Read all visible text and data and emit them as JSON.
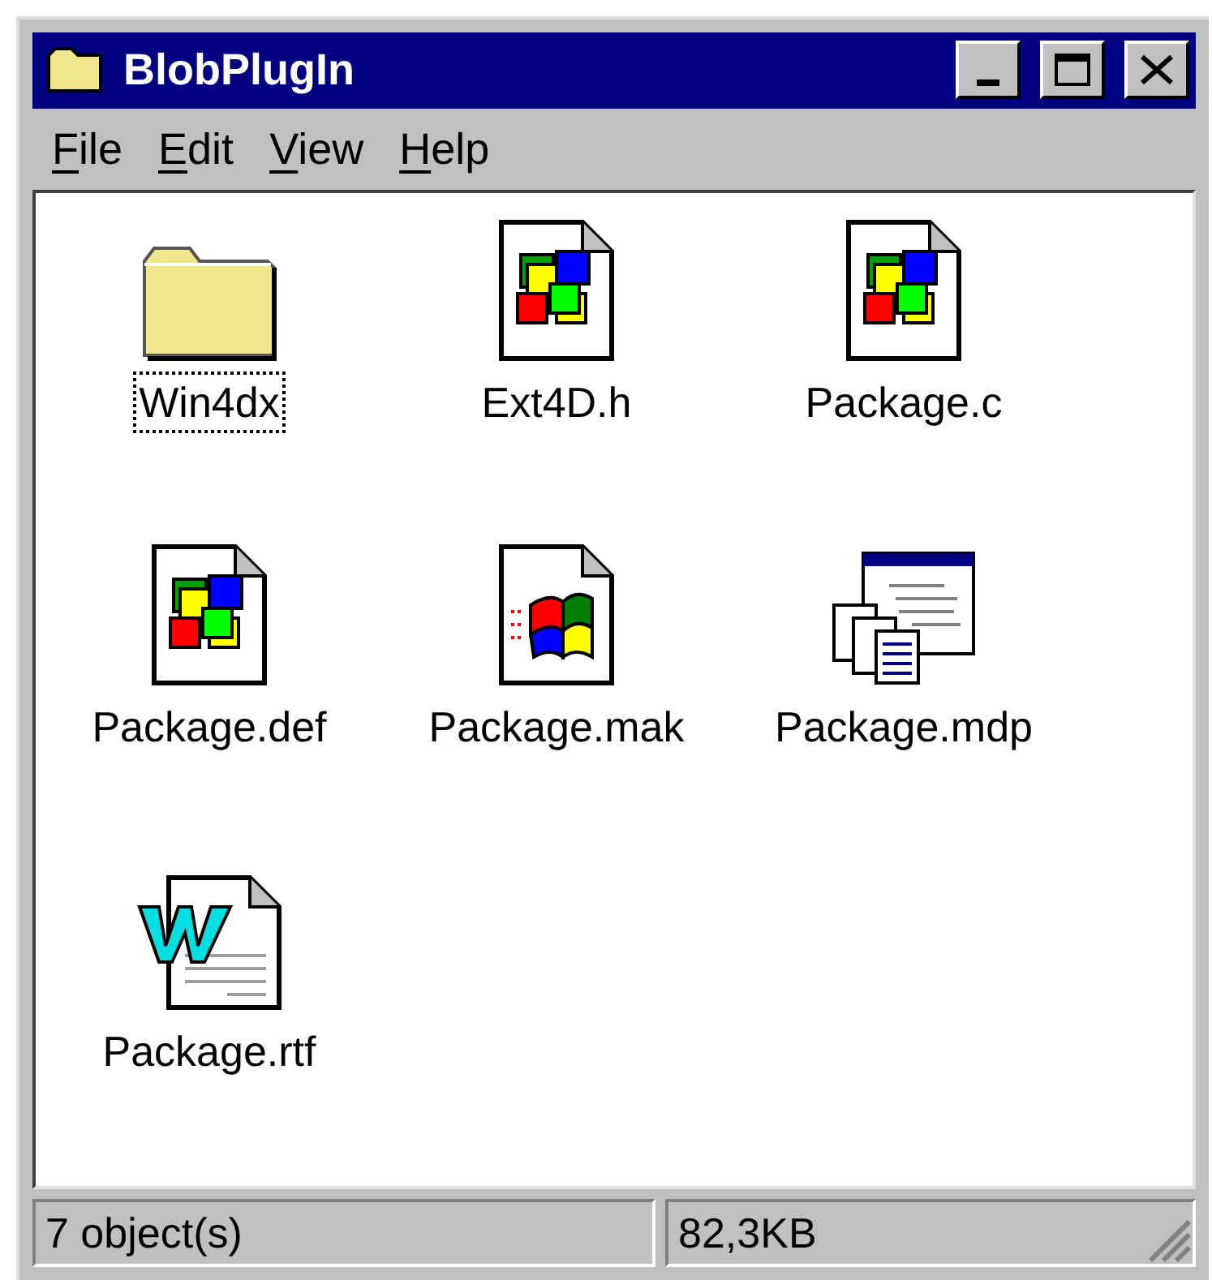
{
  "window": {
    "title": "BlobPlugIn"
  },
  "menu": [
    {
      "label": "File"
    },
    {
      "label": "Edit"
    },
    {
      "label": "View"
    },
    {
      "label": "Help"
    }
  ],
  "items": [
    {
      "name": "Win4dx",
      "kind": "folder",
      "focused": true
    },
    {
      "name": "Ext4D.h",
      "kind": "source",
      "focused": false
    },
    {
      "name": "Package.c",
      "kind": "source",
      "focused": false
    },
    {
      "name": "Package.def",
      "kind": "source",
      "focused": false
    },
    {
      "name": "Package.mak",
      "kind": "make",
      "focused": false
    },
    {
      "name": "Package.mdp",
      "kind": "project",
      "focused": false
    },
    {
      "name": "Package.rtf",
      "kind": "document",
      "focused": false
    }
  ],
  "status_bar": {
    "count": "7 object(s)",
    "size": "82,3KB"
  }
}
